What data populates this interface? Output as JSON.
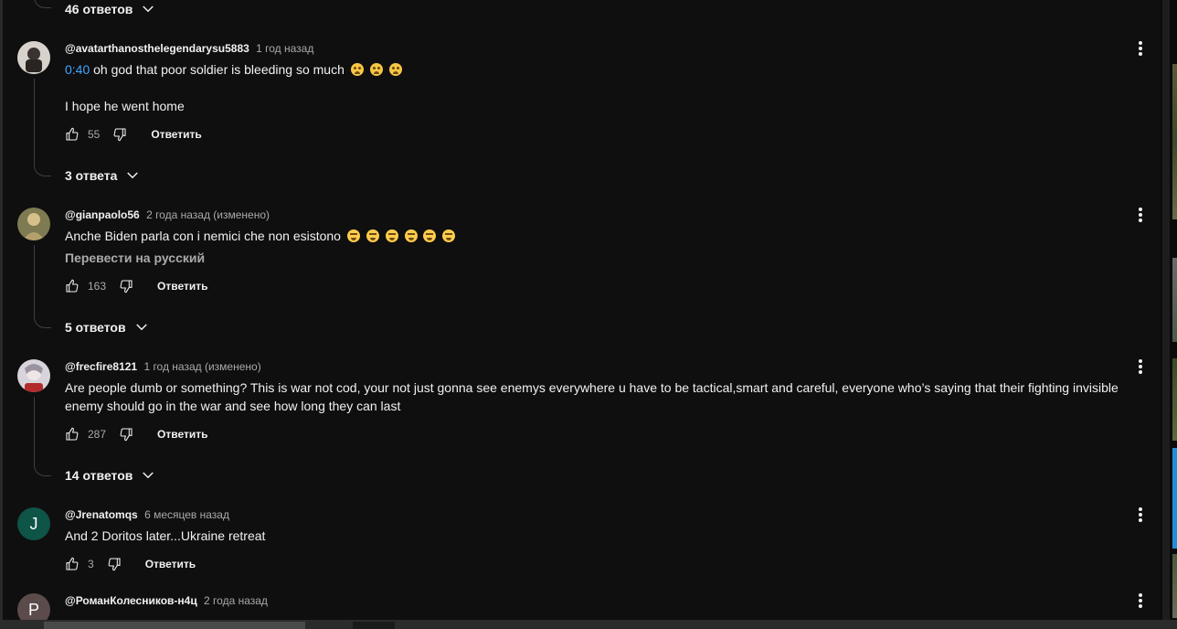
{
  "top_replies": {
    "label": "46 ответов"
  },
  "comments": [
    {
      "author": "@avatarthanosthelegendarysu5883",
      "time": "1 год назад",
      "timestamp": "0:40",
      "line1": " oh god that poor soldier is bleeding so much",
      "line2": "I hope he went home",
      "likes": "55",
      "reply_label": "Ответить",
      "replies_label": "3 ответа",
      "avatar_color": "#6b5a4a"
    },
    {
      "author": "@gianpaolo56",
      "time": "2 года назад (изменено)",
      "text": "Anche Biden parla con i nemici che non esistono",
      "translate_label": "Перевести на русский",
      "likes": "163",
      "reply_label": "Ответить",
      "replies_label": "5 ответов",
      "avatar_color": "#8a7a55"
    },
    {
      "author": "@frecfire8121",
      "time": "1 год назад (изменено)",
      "text": "Are people dumb or something? This is war not cod, your not just gonna see enemys everywhere u have to be tactical,smart and careful, everyone who’s saying that their fighting invisible enemy should go in the war and see how long they can last",
      "likes": "287",
      "reply_label": "Ответить",
      "replies_label": "14 ответов",
      "avatar_color": "#c9c4cc"
    },
    {
      "author": "@Jrenatomqs",
      "time": "6 месяцев назад",
      "text": "And 2 Doritos later...Ukraine retreat",
      "likes": "3",
      "reply_label": "Ответить",
      "avatar_letter": "J",
      "avatar_color": "#0e5447"
    },
    {
      "author": "@РоманКолесников-н4ц",
      "time": "2 года назад",
      "avatar_letter": "Р",
      "avatar_color": "#5b4b4b"
    }
  ],
  "colors": {
    "background": "#0f0f0f",
    "link": "#3ea6ff",
    "muted": "#aaaaaa",
    "text": "#f1f1f1"
  }
}
